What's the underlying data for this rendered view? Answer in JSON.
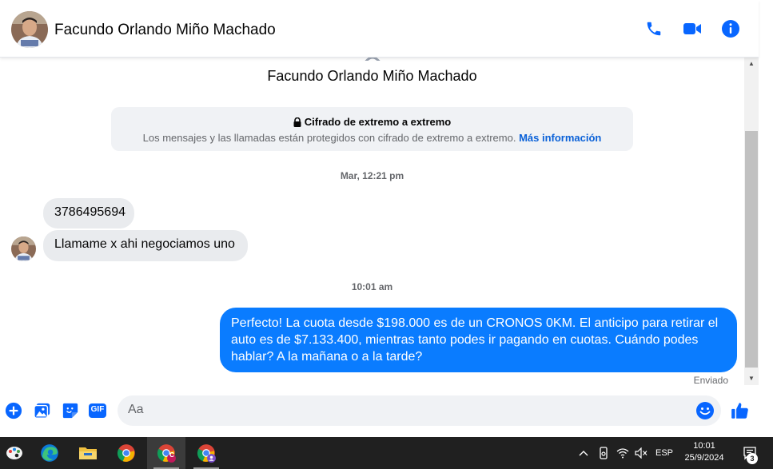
{
  "contact": {
    "name": "Facundo Orlando Miño Machado"
  },
  "encryption": {
    "title": "Cifrado de extremo a extremo",
    "description": "Los mensajes y las llamadas están protegidos con cifrado de extremo a extremo.",
    "link": "Más información"
  },
  "messages": [
    {
      "type": "timestamp",
      "text": "Mar, 12:21 pm"
    },
    {
      "type": "incoming",
      "text": "3786495694"
    },
    {
      "type": "incoming",
      "text": "Llamame x ahi negociamos uno"
    },
    {
      "type": "timestamp",
      "text": "10:01 am"
    },
    {
      "type": "outgoing",
      "text": "Perfecto! La cuota desde $198.000 es de un CRONOS 0KM. El anticipo para retirar el auto es de $7.133.400, mientras tanto podes ir pagando en cuotas. Cuándo podes hablar? A la mañana o a la tarde?"
    }
  ],
  "status": "Enviado",
  "composer": {
    "placeholder": "Aa",
    "gif_label": "GIF"
  },
  "taskbar": {
    "language": "ESP",
    "time": "10:01",
    "date": "25/9/2024",
    "notification_count": "3",
    "chrome_badge": "C"
  },
  "colors": {
    "accent": "#0a7cff",
    "icon_blue": "#0866ff",
    "incoming_bubble": "#e9ebee",
    "taskbar": "#202020"
  }
}
